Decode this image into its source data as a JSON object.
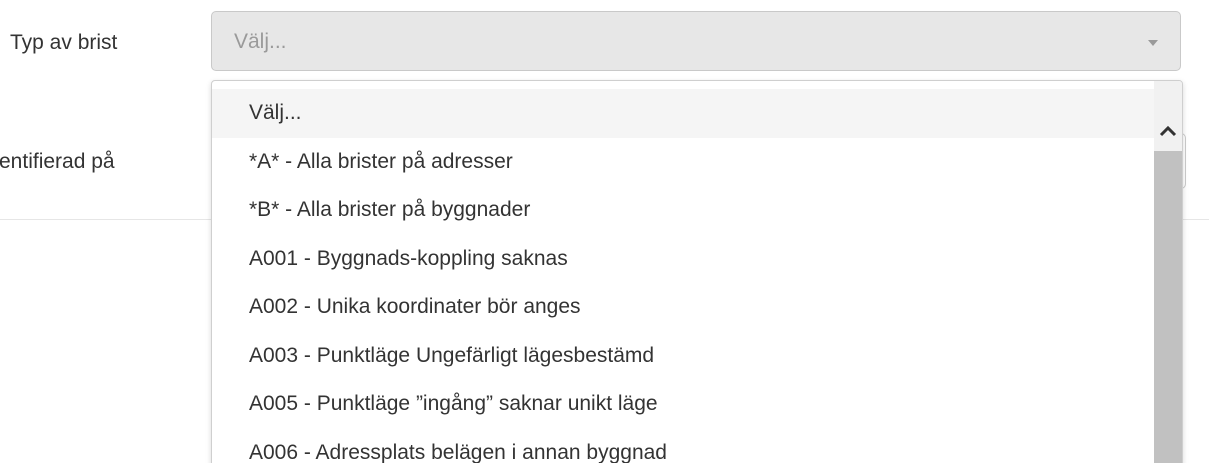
{
  "form": {
    "fields": [
      {
        "label": "Typ av brist"
      },
      {
        "label": "entifierad på"
      }
    ],
    "select": {
      "value": "Välj...",
      "options": [
        "Välj...",
        "*A* - Alla brister på adresser",
        "*B* - Alla brister på byggnader",
        "A001 - Byggnads-koppling saknas",
        "A002 - Unika koordinater bör anges",
        "A003 - Punktläge Ungefärligt lägesbestämd",
        "A005 - Punktläge ”ingång” saknar unikt läge",
        "A006 - Adressplats belägen i annan byggnad"
      ]
    }
  },
  "icons": {
    "caret": "caret-down-icon",
    "scroll_up": "chevron-up-icon"
  },
  "colors": {
    "select_background": "#e7e7e7",
    "highlight": "#f5f5f5",
    "scroll_thumb": "#c1c1c1"
  }
}
